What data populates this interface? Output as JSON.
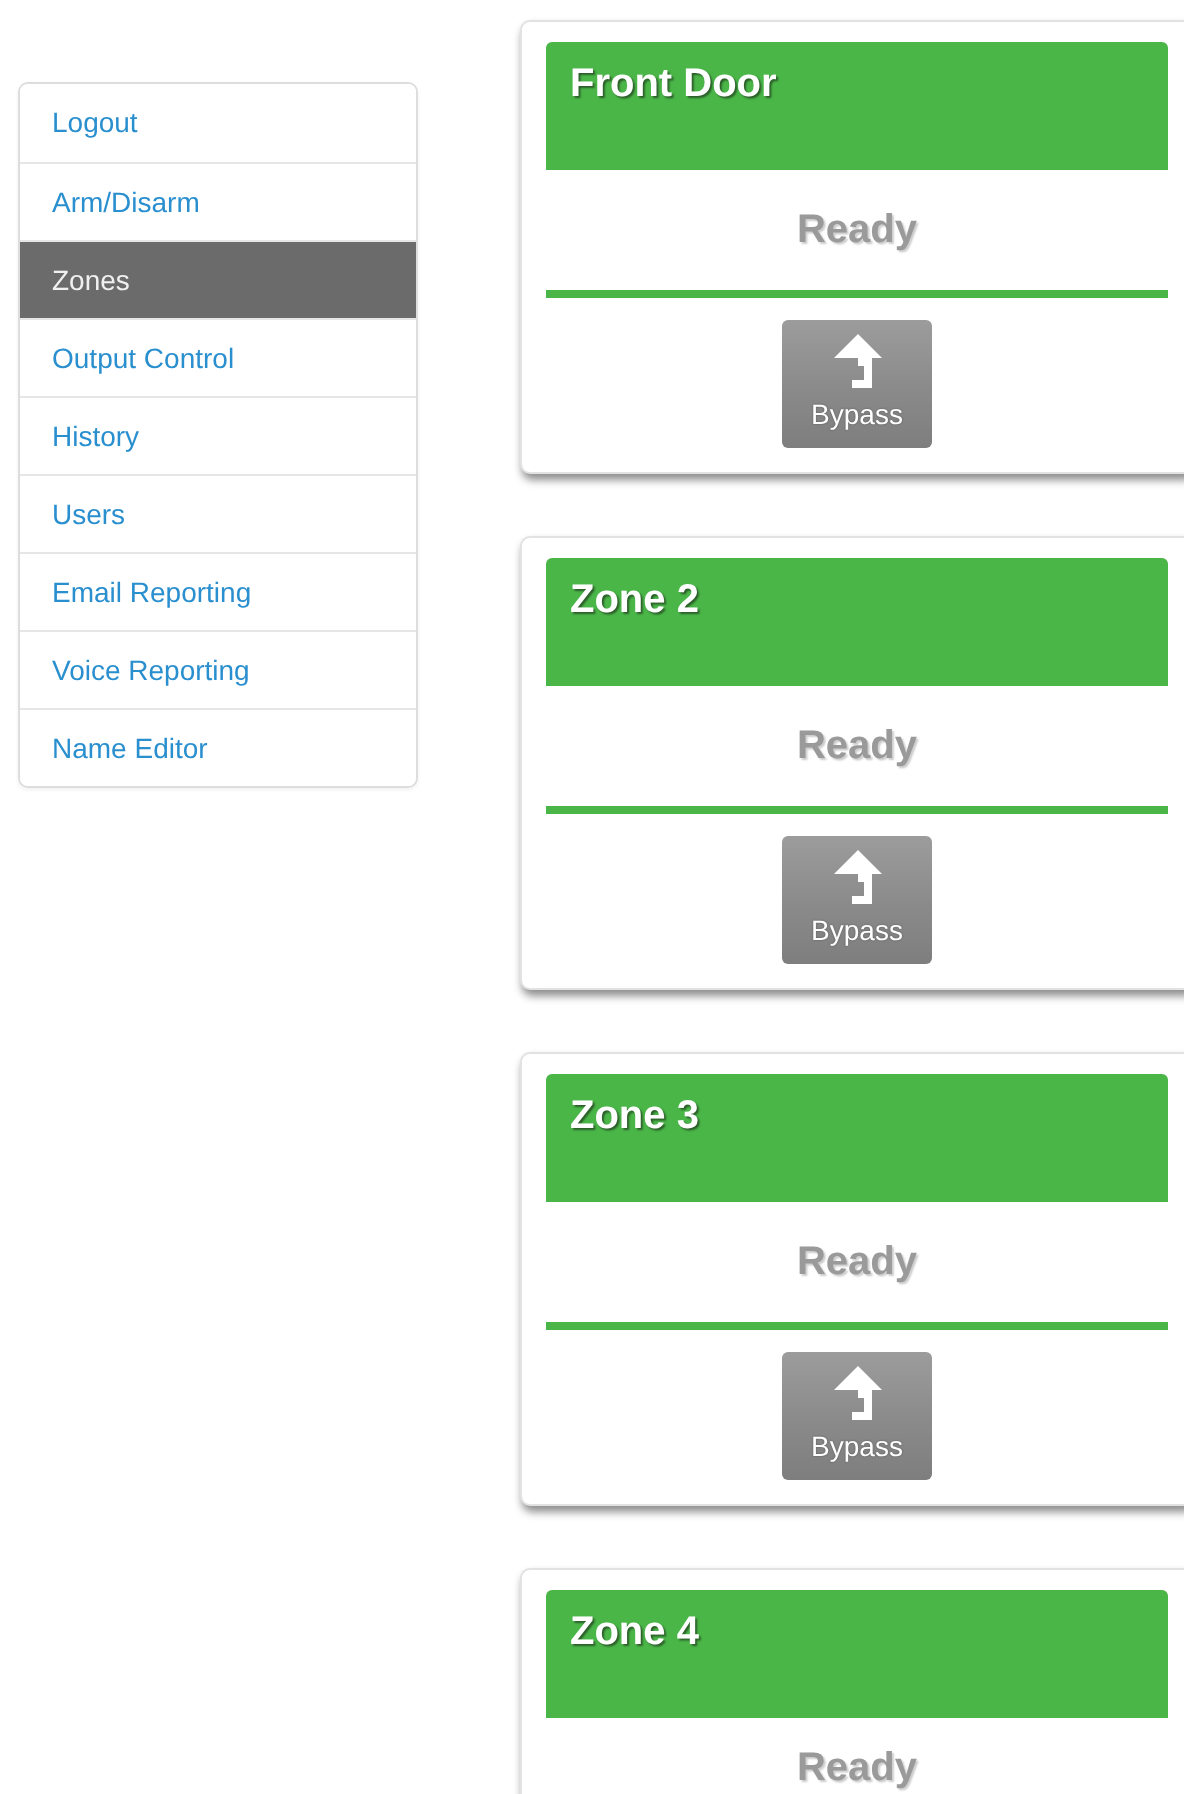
{
  "nav": [
    {
      "label": "Logout",
      "selected": false
    },
    {
      "label": "Arm/Disarm",
      "selected": false
    },
    {
      "label": "Zones",
      "selected": true
    },
    {
      "label": "Output Control",
      "selected": false
    },
    {
      "label": "History",
      "selected": false
    },
    {
      "label": "Users",
      "selected": false
    },
    {
      "label": "Email Reporting",
      "selected": false
    },
    {
      "label": "Voice Reporting",
      "selected": false
    },
    {
      "label": "Name Editor",
      "selected": false
    }
  ],
  "zones": [
    {
      "name": "Front Door",
      "status": "Ready",
      "bypass": "Bypass"
    },
    {
      "name": "Zone 2",
      "status": "Ready",
      "bypass": "Bypass"
    },
    {
      "name": "Zone 3",
      "status": "Ready",
      "bypass": "Bypass"
    },
    {
      "name": "Zone 4",
      "status": "Ready"
    }
  ]
}
